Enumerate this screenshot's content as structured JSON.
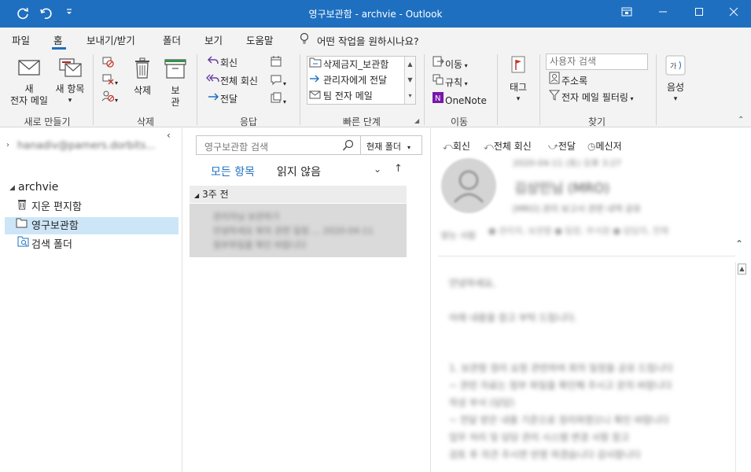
{
  "window": {
    "title": "영구보관함 - archvie  -  Outlook",
    "qat": [
      "sync-icon",
      "undo-icon",
      "customize-icon"
    ],
    "controls": [
      "restore-ribbon-icon",
      "minimize-icon",
      "maximize-icon",
      "close-icon"
    ]
  },
  "tabs": {
    "items": [
      "파일",
      "홈",
      "보내기/받기",
      "폴더",
      "보기",
      "도움말"
    ],
    "active": "홈",
    "tell_me": "어떤 작업을 원하시나요?"
  },
  "ribbon": {
    "new_group": {
      "label": "새로 만들기",
      "new_mail_1": "새",
      "new_mail_2": "전자 메일",
      "new_item_1": "새 항목",
      "new_item_2": "▾"
    },
    "delete_group": {
      "label": "삭제",
      "delete": "삭제",
      "archive_1": "보",
      "archive_2": "관"
    },
    "respond_group": {
      "label": "응답",
      "reply": "회신",
      "reply_all": "전체 회신",
      "forward": "전달"
    },
    "quicksteps_group": {
      "label": "빠른 단계",
      "items": [
        "삭제금지_보관함",
        "관리자에게 전달",
        "팀 전자 메일"
      ]
    },
    "move_group": {
      "label": "이동",
      "move": "이동",
      "rules": "규칙",
      "onenote": "OneNote"
    },
    "tags_group": {
      "label": "",
      "tags": "태그"
    },
    "find_group": {
      "label": "찾기",
      "search_people_placeholder": "사용자 검색",
      "address_book": "주소록",
      "filter_email": "전자 메일 필터링"
    },
    "speech_group": {
      "read_aloud": "음성"
    }
  },
  "nav": {
    "account_blurred": "hanadiv@pamers.dorbits...",
    "account": "archvie",
    "folders": [
      {
        "name": "지운 편지함",
        "icon": "trash-icon"
      },
      {
        "name": "영구보관함",
        "icon": "folder-icon",
        "selected": true
      },
      {
        "name": "검색 폴더",
        "icon": "search-folder-icon"
      }
    ]
  },
  "list": {
    "search_placeholder": "영구보관함 검색",
    "scope": "현재 폴더",
    "filter_all": "모든 항목",
    "filter_unread": "읽지 않음",
    "group": "3주 전",
    "item_line1": "관리자님 보관하기",
    "item_line2": "안녕하세요 회의 관련 일정 … 2020-04-11",
    "item_line3": "첨부파일을 확인 바랍니다"
  },
  "reading": {
    "actions": [
      "회신",
      "전체 회신",
      "전달",
      "메신저"
    ],
    "date_blurred": "2020-04-11 (토) 오후 3:27",
    "sender_blurred": "김상민님 (MRO)",
    "subject_blurred": "[MRO] 관리 보고서 관련 내역 공유",
    "to_label": "받는 사람",
    "recipients_blurred": "● 관리자, 보관함 ● 팀장, 부서원 ● 담당자, 전체",
    "body_blurred": [
      "안녕하세요,",
      "아래 내용을 참고 부탁 드립니다.",
      "1. 보관함 정리 요청 관련하여 회의 일정을 공유 드립니다",
      "~ 관련 자료는 첨부 파일을 확인해 주시고 문의 바랍니다",
      "작성 부서 (담당)",
      "~ 전달 받은 내용 기준으로 정리하였으니 확인 바랍니다",
      "업무 처리 및 담당 관리 시스템 변경 사항 참고",
      "검토 후 의견 주시면 반영 하겠습니다 감사합니다"
    ]
  }
}
